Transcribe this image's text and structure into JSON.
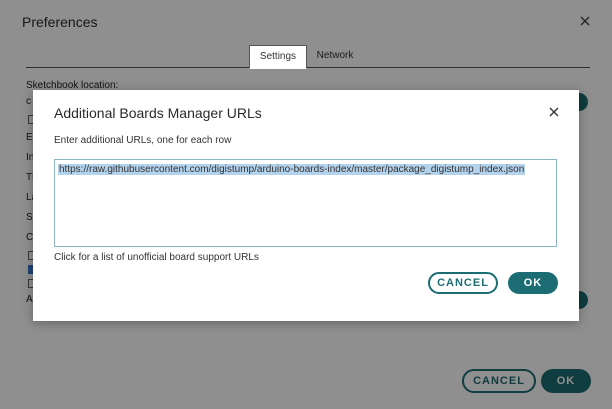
{
  "preferences": {
    "title": "Preferences",
    "tabs": [
      {
        "label": "Settings",
        "active": true
      },
      {
        "label": "Network",
        "active": false
      }
    ],
    "sketchbook_label": "Sketchbook location:",
    "background_labels": [
      "c",
      "E",
      "In",
      "Th",
      "La",
      "S",
      "C",
      "A"
    ],
    "cancel_label": "CANCEL",
    "ok_label": "OK",
    "close_icon": "close-icon"
  },
  "dialog": {
    "title": "Additional Boards Manager URLs",
    "instructions": "Enter additional URLs, one for each row",
    "textarea_value": "https://raw.githubusercontent.com/digistump/arduino-boards-index/master/package_digistump_index.json",
    "link_text": "Click for a list of unofficial board support URLs",
    "cancel_label": "CANCEL",
    "ok_label": "OK",
    "close_icon": "close-icon"
  },
  "colors": {
    "accent": "#1c6d73",
    "selection": "#b3d2ec",
    "overlay": "rgba(0,0,0,0.44)"
  }
}
